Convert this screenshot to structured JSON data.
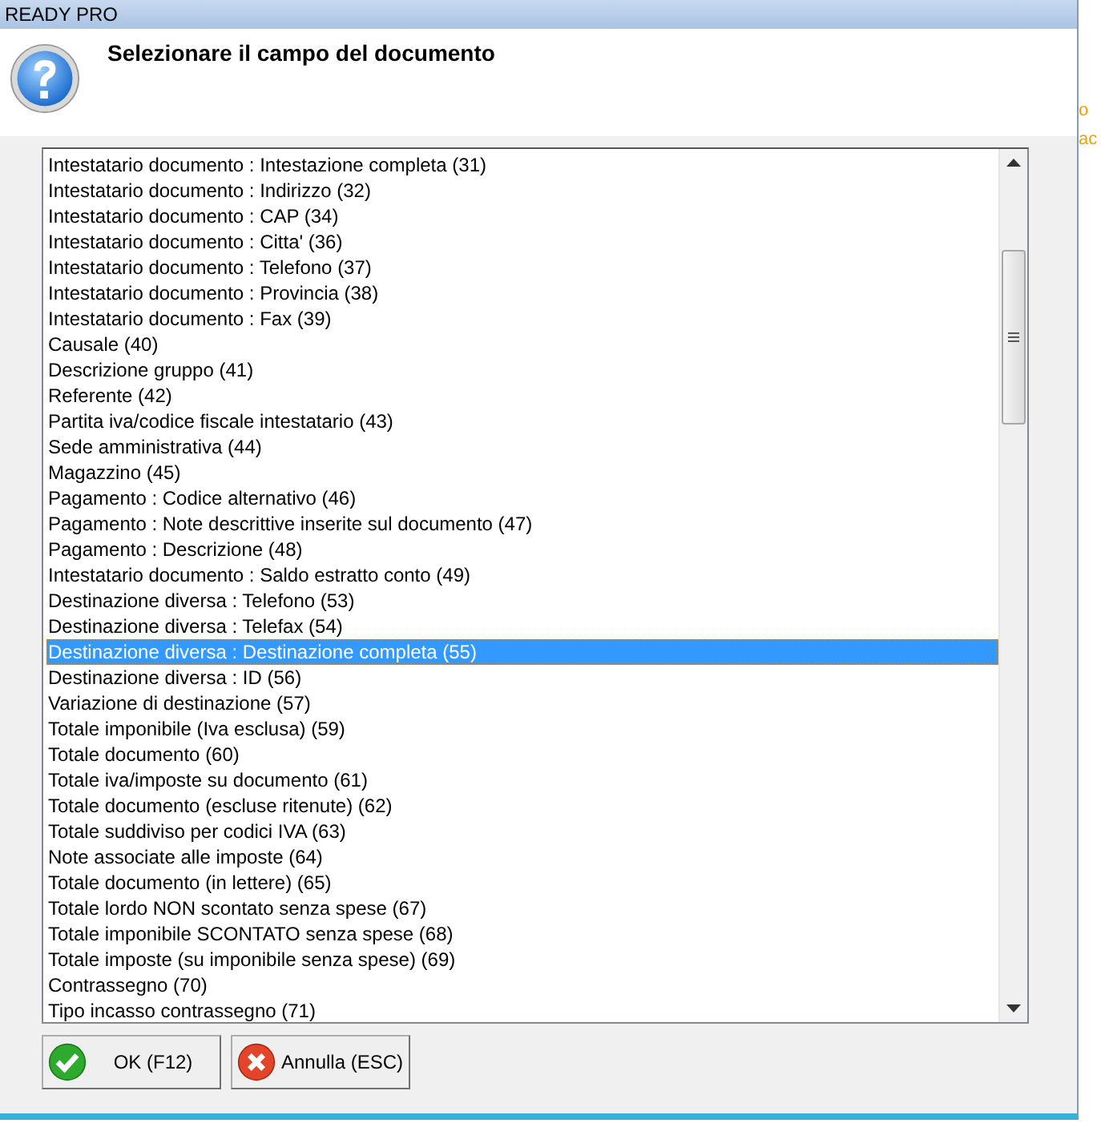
{
  "window": {
    "title": "READY PRO"
  },
  "header": {
    "prompt": "Selezionare il campo del documento"
  },
  "fields": [
    {
      "label": "Intestatario documento : Intestazione completa (31)",
      "selected": false
    },
    {
      "label": "Intestatario documento : Indirizzo (32)",
      "selected": false
    },
    {
      "label": "Intestatario documento : CAP (34)",
      "selected": false
    },
    {
      "label": "Intestatario documento : Citta' (36)",
      "selected": false
    },
    {
      "label": "Intestatario documento : Telefono (37)",
      "selected": false
    },
    {
      "label": "Intestatario documento : Provincia (38)",
      "selected": false
    },
    {
      "label": "Intestatario documento : Fax (39)",
      "selected": false
    },
    {
      "label": "Causale (40)",
      "selected": false
    },
    {
      "label": "Descrizione gruppo (41)",
      "selected": false
    },
    {
      "label": "Referente (42)",
      "selected": false
    },
    {
      "label": "Partita iva/codice fiscale intestatario (43)",
      "selected": false
    },
    {
      "label": "Sede amministrativa (44)",
      "selected": false
    },
    {
      "label": "Magazzino (45)",
      "selected": false
    },
    {
      "label": "Pagamento : Codice alternativo (46)",
      "selected": false
    },
    {
      "label": "Pagamento : Note descrittive inserite sul documento (47)",
      "selected": false
    },
    {
      "label": "Pagamento : Descrizione (48)",
      "selected": false
    },
    {
      "label": "Intestatario documento : Saldo estratto conto (49)",
      "selected": false
    },
    {
      "label": "Destinazione diversa : Telefono (53)",
      "selected": false
    },
    {
      "label": "Destinazione diversa : Telefax (54)",
      "selected": false
    },
    {
      "label": "Destinazione diversa : Destinazione completa (55)",
      "selected": true
    },
    {
      "label": "Destinazione diversa : ID (56)",
      "selected": false
    },
    {
      "label": "Variazione di destinazione (57)",
      "selected": false
    },
    {
      "label": "Totale imponibile (Iva esclusa) (59)",
      "selected": false
    },
    {
      "label": "Totale documento (60)",
      "selected": false
    },
    {
      "label": "Totale iva/imposte su documento (61)",
      "selected": false
    },
    {
      "label": "Totale documento (escluse ritenute) (62)",
      "selected": false
    },
    {
      "label": "Totale suddiviso per codici IVA (63)",
      "selected": false
    },
    {
      "label": "Note associate alle imposte (64)",
      "selected": false
    },
    {
      "label": "Totale documento (in lettere) (65)",
      "selected": false
    },
    {
      "label": "Totale lordo NON scontato senza spese (67)",
      "selected": false
    },
    {
      "label": "Totale imponibile SCONTATO senza spese (68)",
      "selected": false
    },
    {
      "label": "Totale imposte (su imponibile senza spese) (69)",
      "selected": false
    },
    {
      "label": "Contrassegno (70)",
      "selected": false
    },
    {
      "label": "Tipo incasso contrassegno (71)",
      "selected": false
    }
  ],
  "buttons": [
    {
      "label": "OK (F12)",
      "kind": "ok"
    },
    {
      "label": "Annulla (ESC)",
      "kind": "cancel"
    }
  ],
  "background_text": [
    "o",
    "ac"
  ]
}
